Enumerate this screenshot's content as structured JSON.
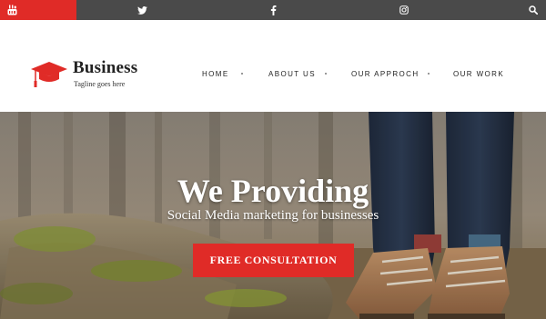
{
  "topbar": {
    "icons": [
      "youtube-icon",
      "twitter-icon",
      "facebook-icon",
      "instagram-icon",
      "search-icon"
    ],
    "accent_color": "#e02b27",
    "bar_color": "#4a4a4a"
  },
  "header": {
    "brand": "Business",
    "tagline": "Tagline goes here",
    "logo_icon": "graduation-cap-icon",
    "logo_color": "#e02b27"
  },
  "nav": {
    "items": [
      {
        "label": "HOME"
      },
      {
        "label": "ABOUT US"
      },
      {
        "label": "OUR APPROCH"
      },
      {
        "label": "OUR WORK"
      }
    ]
  },
  "hero": {
    "title": "We Providing",
    "subtitle": "Social Media marketing for businesses",
    "cta_label": "FREE CONSULTATION",
    "cta_color": "#e02b27"
  }
}
